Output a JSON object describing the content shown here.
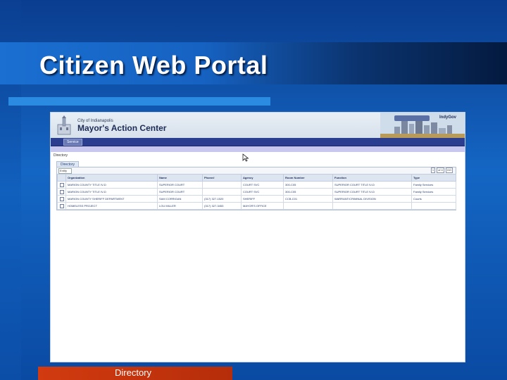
{
  "slide": {
    "title": "Citizen Web Portal",
    "footer_label": "Directory"
  },
  "app": {
    "city_name": "City of Indianapolis",
    "title": "Mayor's Action Center",
    "brand": "IndyGov",
    "nav_tab": "Service",
    "breadcrumb": "Directory",
    "section_tab": "Directory",
    "filter_value": "Entity",
    "pager": [
      "1",
      "of 4",
      "GO"
    ]
  },
  "table": {
    "columns": [
      "Organization",
      "Name",
      "Phone#",
      "Agency",
      "Room Number",
      "Function",
      "Type"
    ],
    "rows": [
      [
        "MARION COUNTY TITLE IV-D",
        "SUPERIOR COURT",
        "",
        "COURT SVC",
        "300-C05",
        "SUPERIOR COURT TITLE IV-D",
        "Family Services"
      ],
      [
        "MARION COUNTY TITLE IV-D",
        "SUPERIOR COURT",
        "",
        "COURT SVC",
        "300-C05",
        "SUPERIOR COURT TITLE IV-D",
        "Family Services"
      ],
      [
        "MARION COUNTY SHERIFF DEPARTMENT",
        "SAM CORRIGAN",
        "(317) 327-1520",
        "SHERIFF",
        "CCB-C01",
        "WARRANT/CRIMINAL DIVISION",
        "Courts"
      ],
      [
        "HOMELESS PROJECT",
        "LOU MILLER",
        "(317) 327-3453",
        "MAYOR'S OFFICE",
        "",
        "",
        ""
      ]
    ]
  },
  "colors": {
    "background": "#1466c4",
    "footer_bar": "#d23b10",
    "accent_bar": "#2a8be0",
    "nav_bar": "#2b3d8f"
  }
}
